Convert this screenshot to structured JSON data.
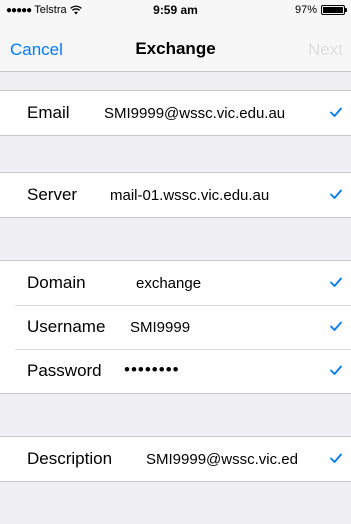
{
  "status": {
    "carrier": "Telstra",
    "time": "9:59 am",
    "battery": "97%"
  },
  "nav": {
    "cancel": "Cancel",
    "title": "Exchange",
    "next": "Next"
  },
  "fields": {
    "email": {
      "label": "Email",
      "value": "SMI9999@wssc.vic.edu.au"
    },
    "server": {
      "label": "Server",
      "value": "mail-01.wssc.vic.edu.au"
    },
    "domain": {
      "label": "Domain",
      "value": "exchange"
    },
    "username": {
      "label": "Username",
      "value": "SMI9999"
    },
    "password": {
      "label": "Password",
      "value": "••••••••"
    },
    "description": {
      "label": "Description",
      "value": "SMI9999@wssc.vic.ed"
    }
  },
  "colors": {
    "accent": "#007aff",
    "background": "#efeff4"
  },
  "icons": {
    "check": "checkmark-icon",
    "wifi": "wifi-icon",
    "battery": "battery-icon"
  }
}
